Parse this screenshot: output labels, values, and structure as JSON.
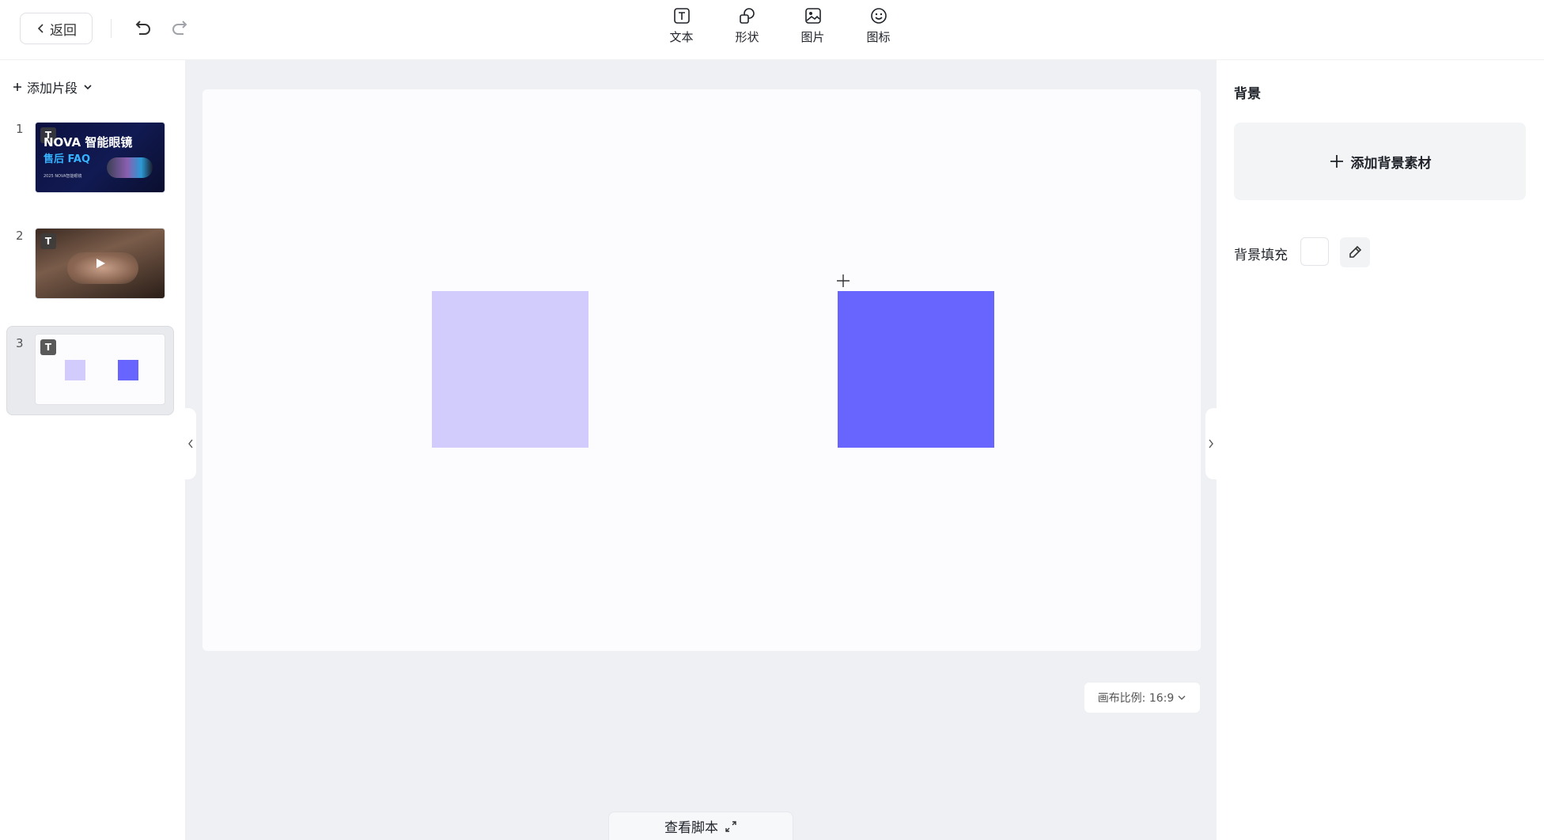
{
  "toolbar": {
    "back_label": "返回",
    "tools": [
      {
        "label": "文本",
        "icon": "text-icon"
      },
      {
        "label": "形状",
        "icon": "shape-icon"
      },
      {
        "label": "图片",
        "icon": "image-icon"
      },
      {
        "label": "图标",
        "icon": "smiley-icon"
      }
    ]
  },
  "segments": {
    "add_label": "添加片段",
    "items": [
      {
        "num": "1",
        "badge": "T",
        "title_line1": "NOVA 智能眼镜",
        "title_line2": "售后 FAQ",
        "footer": "2025 NOVA智能眼镜"
      },
      {
        "num": "2",
        "badge": "T"
      },
      {
        "num": "3",
        "badge": "T"
      }
    ]
  },
  "canvas": {
    "background": "#fcfcff",
    "shape_colors": [
      "#d2ccfd",
      "#6865ff"
    ],
    "ratio_label": "画布比例: 16:9",
    "script_label": "查看脚本"
  },
  "right_panel": {
    "title": "背景",
    "add_bg_label": "添加背景素材",
    "fill_label": "背景填充"
  }
}
